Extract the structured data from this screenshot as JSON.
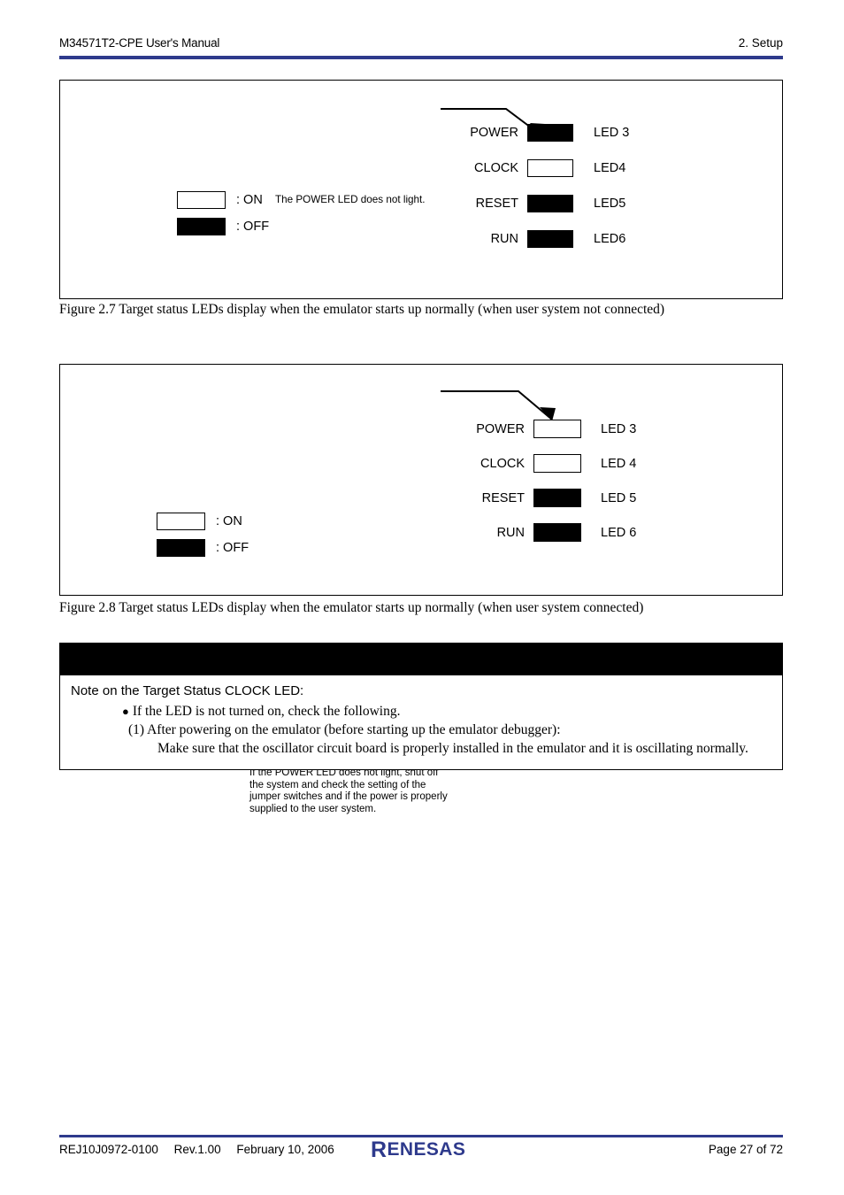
{
  "header": {
    "left_text": "M34571T2-CPE User's Manual",
    "right_text": "2. Setup",
    "rule_color": "#2e3a8c"
  },
  "figure_1": {
    "note": "The POWER LED does not light.",
    "pointer_icon": "arrow-pointer-icon",
    "leds": [
      {
        "name": "POWER",
        "state": "OFF",
        "code": "LED 3"
      },
      {
        "name": "CLOCK",
        "state": "ON",
        "code": "LED4"
      },
      {
        "name": "RESET",
        "state": "OFF",
        "code": "LED5"
      },
      {
        "name": "RUN",
        "state": "OFF",
        "code": "LED6"
      }
    ],
    "legend": [
      {
        "state": "ON",
        "label": ": ON"
      },
      {
        "state": "OFF",
        "label": ": OFF"
      }
    ],
    "caption": "Figure 2.7 Target status LEDs display when the emulator starts up normally (when user system not connected)"
  },
  "figure_2": {
    "note": "If the POWER LED does not light, shut off\nthe system and check the setting of the\njumper switches and if the power is properly\nsupplied to the user system.",
    "pointer_icon": "arrow-pointer-icon",
    "leds": [
      {
        "name": "POWER",
        "state": "ON",
        "code": "LED 3"
      },
      {
        "name": "CLOCK",
        "state": "ON",
        "code": "LED 4"
      },
      {
        "name": "RESET",
        "state": "OFF",
        "code": "LED 5"
      },
      {
        "name": "RUN",
        "state": "OFF",
        "code": "LED 6"
      }
    ],
    "legend": [
      {
        "state": "ON",
        "label": ": ON"
      },
      {
        "state": "OFF",
        "label": ": OFF"
      }
    ],
    "caption": "Figure 2.8 Target status LEDs display when the emulator starts up normally (when user system connected)"
  },
  "note_panel": {
    "header_bar_text": "",
    "title": "Note on the Target Status CLOCK LED:",
    "bullet": "If the LED is not turned on, check the following.",
    "item_1": "(1) After powering on the emulator (before starting up the emulator debugger):",
    "item_1_detail": "Make sure that the oscillator circuit board is properly installed in the emulator and it is oscillating normally."
  },
  "footer": {
    "doc_number": "REJ10J0972-0100",
    "revision": "Rev.1.00",
    "date": "February 10, 2006",
    "logo_r": "R",
    "logo_text": "ENESAS",
    "logo_color": "#2e3a8c",
    "page_info": "Page 27 of 72"
  }
}
